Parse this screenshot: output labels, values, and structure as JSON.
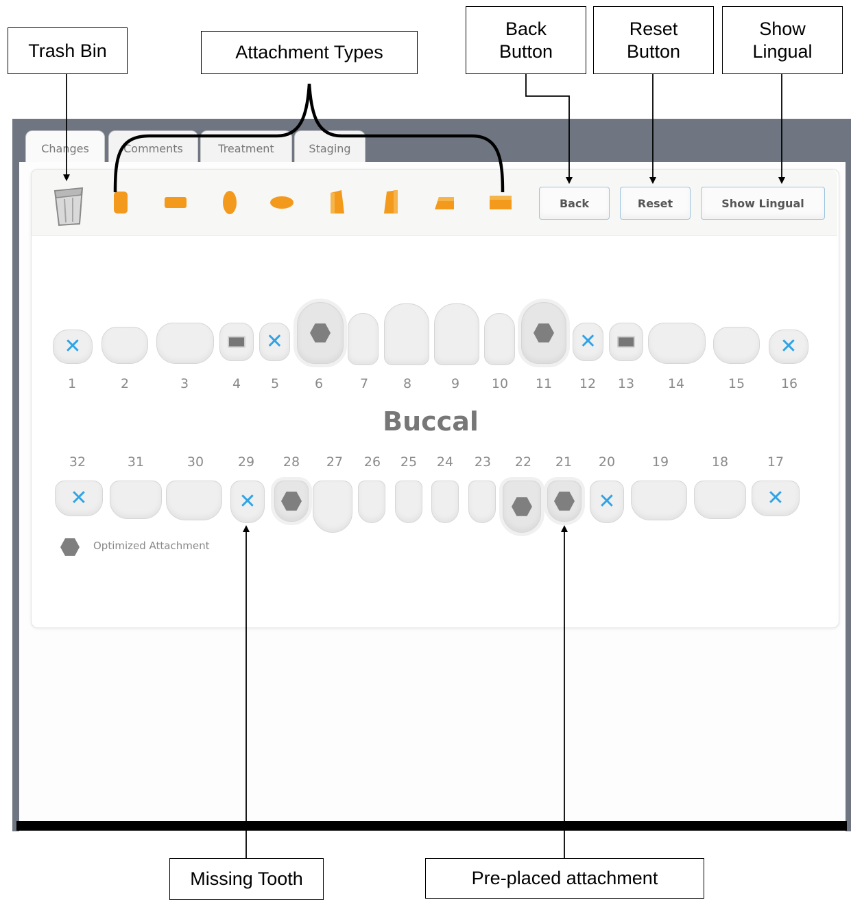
{
  "callouts": {
    "trash_bin": "Trash Bin",
    "attachment_types": "Attachment Types",
    "back_button": [
      "Back",
      "Button"
    ],
    "reset_button": [
      "Reset",
      "Button"
    ],
    "show_lingual": [
      "Show",
      "Lingual"
    ],
    "missing_tooth": "Missing Tooth",
    "pre_placed_attachment": "Pre-placed attachment"
  },
  "tabs": [
    "Changes",
    "Comments",
    "Treatment",
    "Staging"
  ],
  "toolbar": {
    "trash_icon": "trash-bin-icon",
    "attachment_icons": [
      "vertical-rectangle-attachment-icon",
      "horizontal-rectangle-attachment-icon",
      "vertical-ellipse-attachment-icon",
      "horizontal-ellipse-attachment-icon",
      "vertical-bevel-attachment-icon",
      "vertical-bevel-reverse-attachment-icon",
      "horizontal-bevel-attachment-icon",
      "horizontal-bevel-reverse-attachment-icon"
    ],
    "back_label": "Back",
    "reset_label": "Reset",
    "show_lingual_label": "Show Lingual"
  },
  "view_label": "Buccal",
  "upper_teeth": [
    {
      "num": "1",
      "state": "missing"
    },
    {
      "num": "2",
      "state": "normal"
    },
    {
      "num": "3",
      "state": "normal"
    },
    {
      "num": "4",
      "state": "attachment"
    },
    {
      "num": "5",
      "state": "missing"
    },
    {
      "num": "6",
      "state": "optimized"
    },
    {
      "num": "7",
      "state": "normal"
    },
    {
      "num": "8",
      "state": "normal"
    },
    {
      "num": "9",
      "state": "normal"
    },
    {
      "num": "10",
      "state": "normal"
    },
    {
      "num": "11",
      "state": "optimized"
    },
    {
      "num": "12",
      "state": "missing"
    },
    {
      "num": "13",
      "state": "attachment"
    },
    {
      "num": "14",
      "state": "normal"
    },
    {
      "num": "15",
      "state": "normal"
    },
    {
      "num": "16",
      "state": "missing"
    }
  ],
  "lower_teeth": [
    {
      "num": "32",
      "state": "missing"
    },
    {
      "num": "31",
      "state": "normal"
    },
    {
      "num": "30",
      "state": "normal"
    },
    {
      "num": "29",
      "state": "missing"
    },
    {
      "num": "28",
      "state": "optimized"
    },
    {
      "num": "27",
      "state": "normal"
    },
    {
      "num": "26",
      "state": "normal"
    },
    {
      "num": "25",
      "state": "normal"
    },
    {
      "num": "24",
      "state": "normal"
    },
    {
      "num": "23",
      "state": "normal"
    },
    {
      "num": "22",
      "state": "optimized"
    },
    {
      "num": "21",
      "state": "optimized"
    },
    {
      "num": "20",
      "state": "missing"
    },
    {
      "num": "19",
      "state": "normal"
    },
    {
      "num": "18",
      "state": "normal"
    },
    {
      "num": "17",
      "state": "missing"
    }
  ],
  "legend": {
    "label": "Optimized Attachment"
  },
  "colors": {
    "attachment_orange": "#f39a1c",
    "missing_x_blue": "#2fa3e6",
    "optimized_gray": "#7f7f7f",
    "window_frame": "#6f7581",
    "button_border": "#9cc3dd"
  }
}
